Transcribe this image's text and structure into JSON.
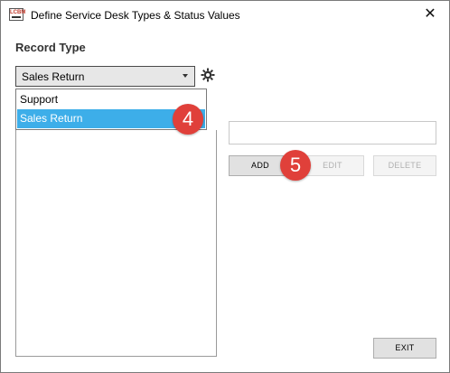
{
  "window": {
    "title": "Define Service Desk Types & Status Values",
    "close_glyph": "✕",
    "app_icon_text": "LCBM"
  },
  "record_type": {
    "label": "Record Type",
    "selected": "Sales Return",
    "options": [
      "Support",
      "Sales Return"
    ],
    "highlighted_option": "Sales Return"
  },
  "actions": {
    "add": "ADD",
    "edit": "EDIT",
    "delete": "DELETE",
    "exit": "EXIT"
  },
  "markers": {
    "m4": "4",
    "m5": "5"
  },
  "colors": {
    "highlight": "#3daee9",
    "marker": "#e0403a"
  },
  "icons": {
    "gear": "gear-icon",
    "dropdown_arrow": "chevron-down-icon",
    "close": "close-icon"
  }
}
